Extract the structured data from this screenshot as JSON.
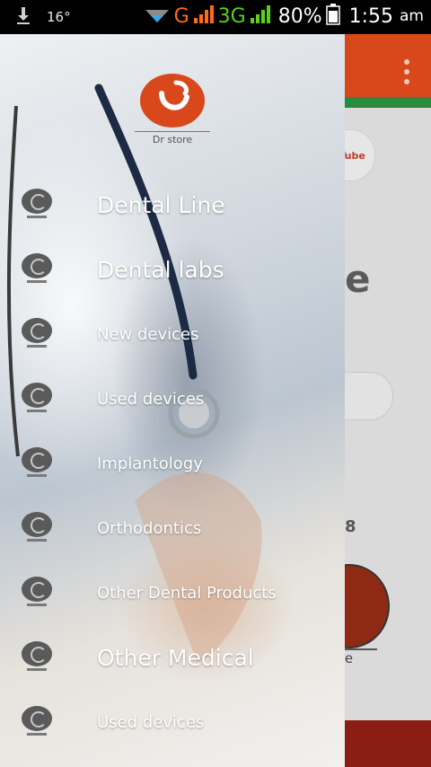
{
  "status_bar": {
    "temperature": "16°",
    "network_type_g": "G",
    "network_type_3g": "3G",
    "battery_percent": "80%",
    "time": "1:55",
    "ampm": "am",
    "icons": [
      "download-icon",
      "wifi-icon",
      "signal-icon",
      "battery-icon"
    ]
  },
  "background_app": {
    "toolbar_color": "#d8481a",
    "accent_color": "#2b8a3e",
    "youtube_label": "You Tube",
    "partial_heading": "e",
    "partial_number": "8",
    "partial_logo_text": "re"
  },
  "drawer": {
    "logo_text": "Dr store",
    "brand_color": "#d8481a",
    "items": [
      {
        "label": "Dental Line",
        "size": "large"
      },
      {
        "label": "Dental labs",
        "size": "large"
      },
      {
        "label": "New devices",
        "size": "small"
      },
      {
        "label": "Used devices",
        "size": "small"
      },
      {
        "label": "Implantology",
        "size": "small"
      },
      {
        "label": "Orthodontics",
        "size": "small"
      },
      {
        "label": "Other Dental Products",
        "size": "small"
      },
      {
        "label": "Other Medical",
        "size": "large"
      },
      {
        "label": "Used devices",
        "size": "small"
      }
    ]
  }
}
